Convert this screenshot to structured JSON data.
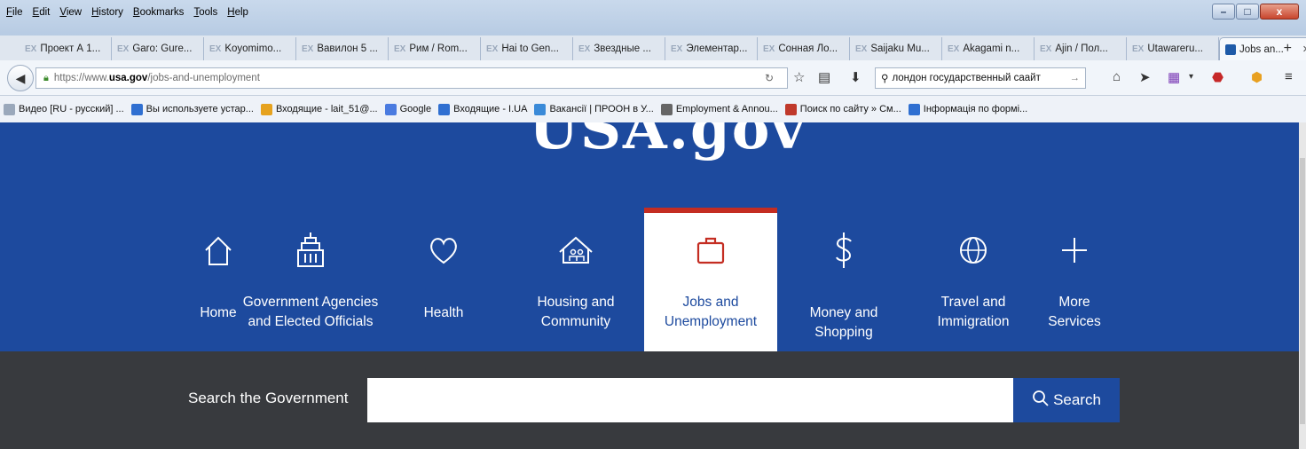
{
  "menu": [
    "File",
    "Edit",
    "View",
    "History",
    "Bookmarks",
    "Tools",
    "Help"
  ],
  "tabs": [
    {
      "label": "Проект А 1...",
      "active": false
    },
    {
      "label": "Garo: Gure...",
      "active": false
    },
    {
      "label": "Koyomimo...",
      "active": false
    },
    {
      "label": "Вавилон 5 ...",
      "active": false
    },
    {
      "label": "Рим / Rom...",
      "active": false
    },
    {
      "label": "Hai to Gen...",
      "active": false
    },
    {
      "label": "Звездные ...",
      "active": false
    },
    {
      "label": "Элементар...",
      "active": false
    },
    {
      "label": "Сонная Ло...",
      "active": false
    },
    {
      "label": "Saijaku Mu...",
      "active": false
    },
    {
      "label": "Akagami n...",
      "active": false
    },
    {
      "label": "Ajin / Пол...",
      "active": false
    },
    {
      "label": "Utawareru...",
      "active": false
    },
    {
      "label": "Jobs an...",
      "active": true
    }
  ],
  "tab_prefix": "EX",
  "url": {
    "prefix": "https://www.",
    "domain": "usa.gov",
    "path": "/jobs-and-unemployment"
  },
  "search_text": "лондон государственный саайт",
  "bookmarks": [
    {
      "label": "Видео [RU - русский] ...",
      "icon": "ex-icon",
      "color": "#9aa8bb"
    },
    {
      "label": "Вы используете устар...",
      "icon": "b-icon",
      "color": "#2f6fd1"
    },
    {
      "label": "Входящие - lait_51@...",
      "icon": "mail-icon",
      "color": "#e6a21e"
    },
    {
      "label": "Google",
      "icon": "google-icon",
      "color": "#4a7be0"
    },
    {
      "label": "Входящие - I.UA",
      "icon": "info-icon",
      "color": "#2f6fd1"
    },
    {
      "label": "Вакансії | ПРООН в У...",
      "icon": "un-icon",
      "color": "#3a8ad8"
    },
    {
      "label": "Employment & Annou...",
      "icon": "un-emblem-icon",
      "color": "#666666"
    },
    {
      "label": "Поиск по сайту » См...",
      "icon": "site-icon",
      "color": "#c0392b"
    },
    {
      "label": "Інформація по формі...",
      "icon": "info-icon",
      "color": "#2f6fd1"
    }
  ],
  "site": {
    "logo": "USA.gov",
    "nav": [
      {
        "label": "Home",
        "icon": "home-icon",
        "active": false
      },
      {
        "label": "Government Agencies and Elected Officials",
        "line1": "Government Agencies",
        "line2": "and Elected Officials",
        "icon": "capitol-icon",
        "active": false
      },
      {
        "label": "Health",
        "icon": "heart-icon",
        "active": false
      },
      {
        "label": "Housing and Community",
        "line1": "Housing and",
        "line2": "Community",
        "icon": "house-people-icon",
        "active": false
      },
      {
        "label": "Jobs and Unemployment",
        "line1": "Jobs and",
        "line2": "Unemployment",
        "icon": "briefcase-icon",
        "active": true
      },
      {
        "label": "Money and Shopping",
        "icon": "dollar-icon",
        "active": false
      },
      {
        "label": "Travel and Immigration",
        "line1": "Travel and",
        "line2": "Immigration",
        "icon": "globe-icon",
        "active": false
      },
      {
        "label": "More Services",
        "line1": "More",
        "line2": "Services",
        "icon": "plus-icon",
        "active": false
      }
    ],
    "search_label": "Search the Government",
    "search_button": "Search"
  },
  "colors": {
    "brand_blue": "#1d4a9e",
    "active_accent": "#c42d22",
    "search_band": "#383a3e"
  }
}
